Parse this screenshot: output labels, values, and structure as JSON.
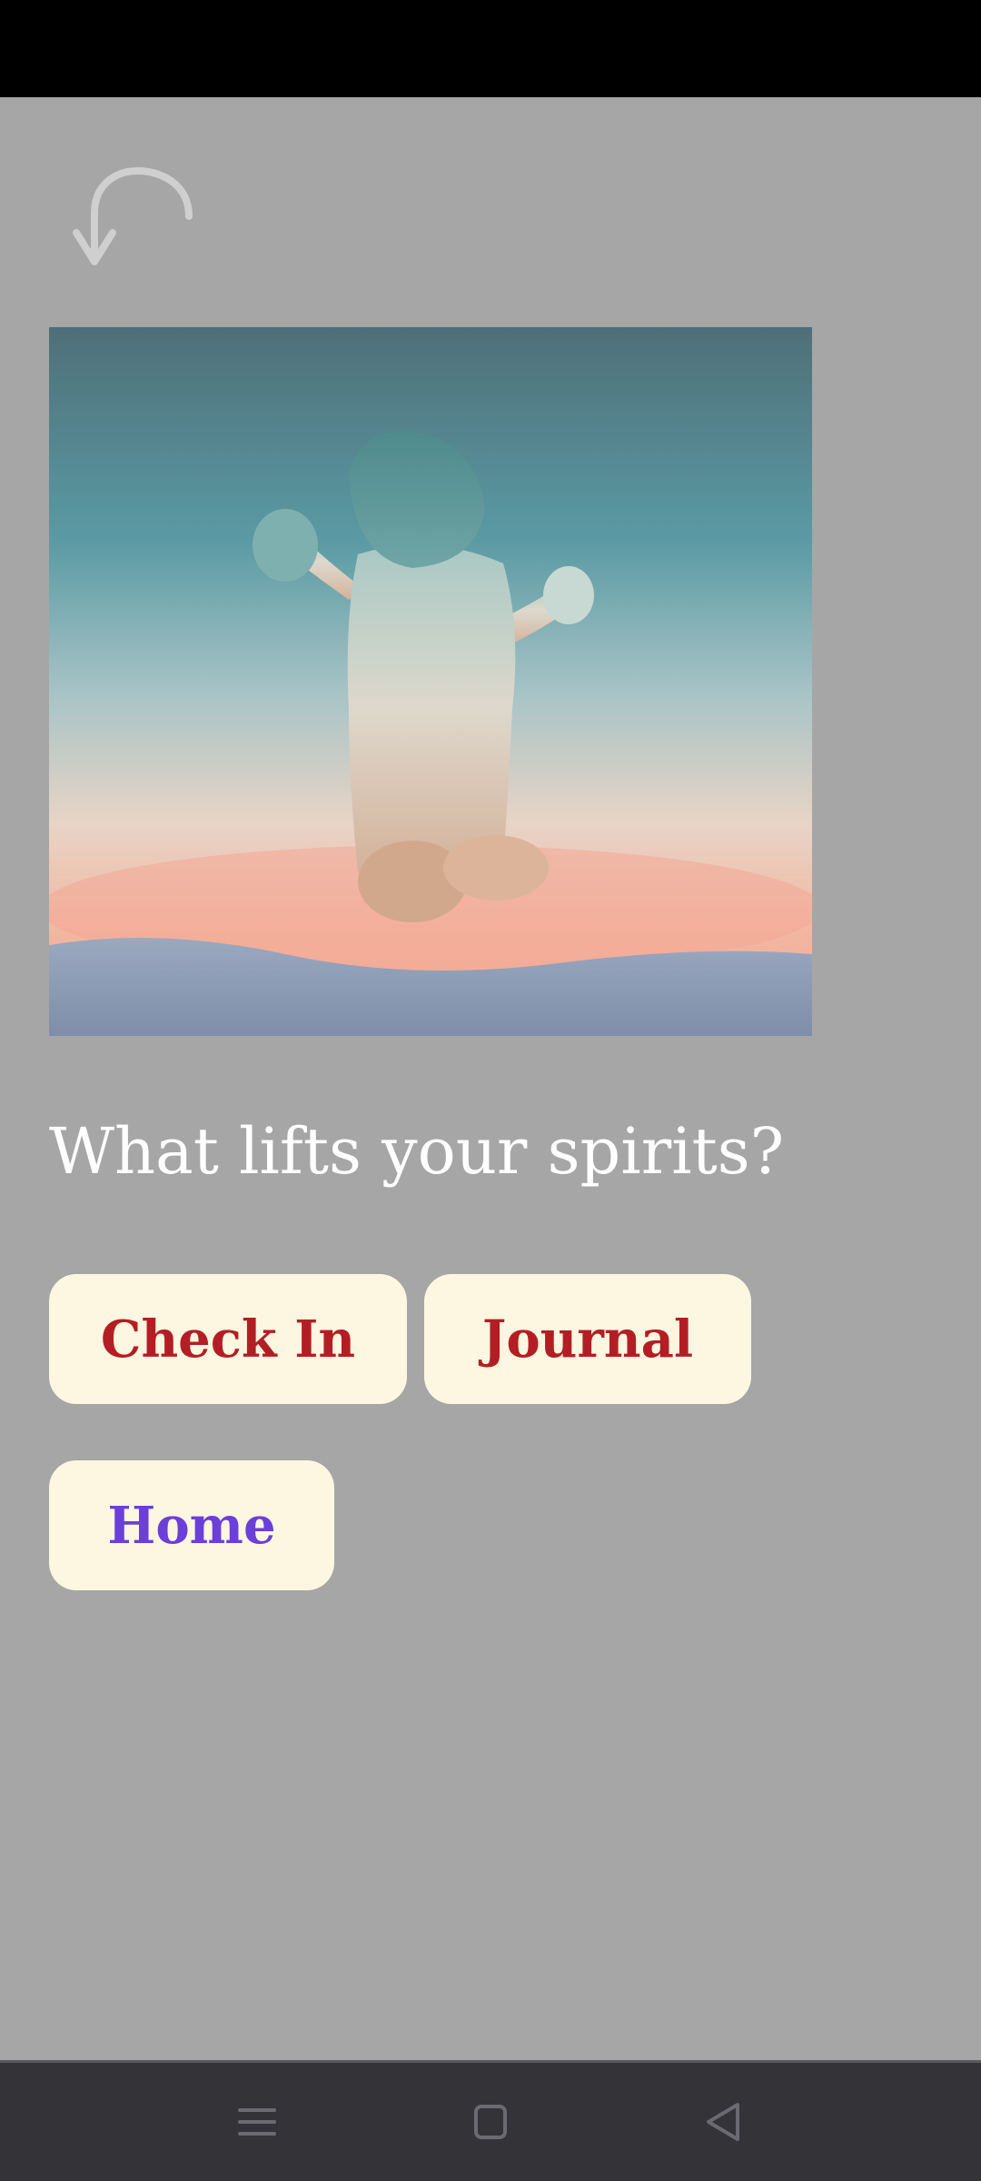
{
  "screen": {
    "prompt": "What lifts your spirits?"
  },
  "buttons": {
    "check_in": "Check In",
    "journal": "Journal",
    "home": "Home"
  },
  "icons": {
    "back": "undo-arrow-icon",
    "nav_menu": "menu-icon",
    "nav_home": "square-home-icon",
    "nav_back": "triangle-back-icon"
  },
  "colors": {
    "background": "#a6a6a6",
    "button_bg": "#fdf6e1",
    "primary_text": "#b31e24",
    "home_text": "#6b3fd8",
    "prompt_text": "#ffffff",
    "nav_bar": "#333338"
  }
}
